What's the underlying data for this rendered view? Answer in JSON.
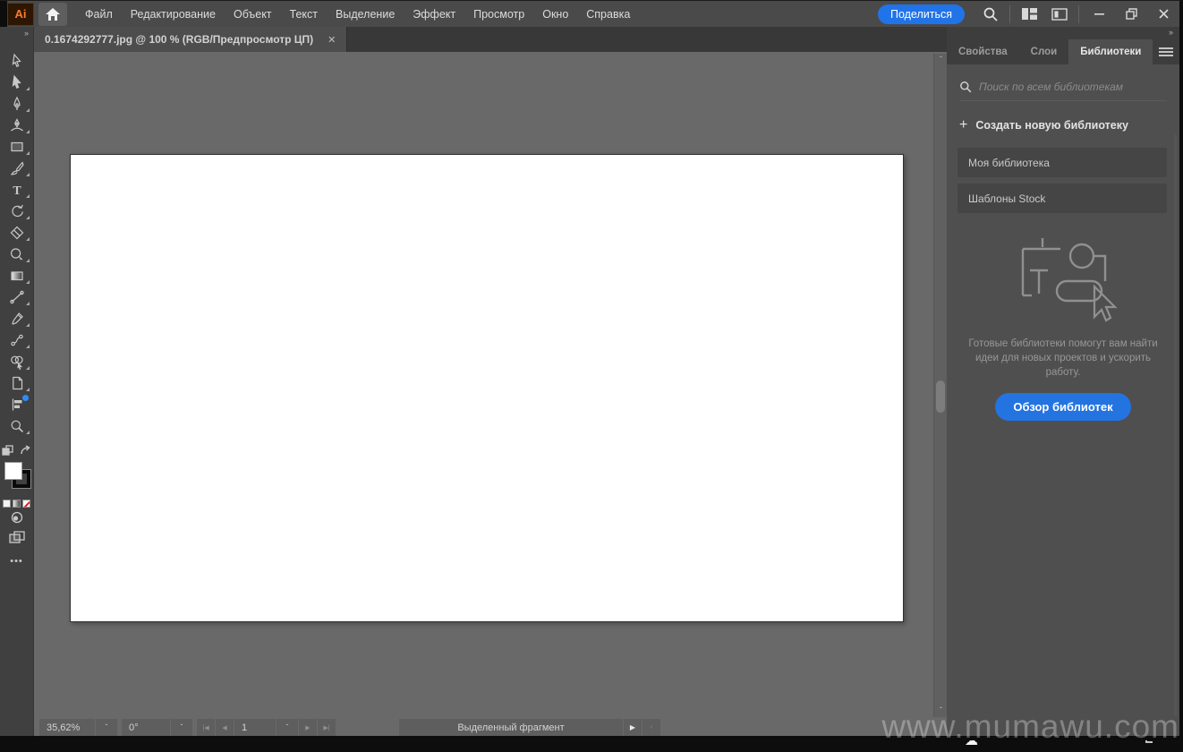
{
  "titlebar": {
    "app_badge": "Ai",
    "menu_items": [
      {
        "id": "file",
        "label": "Файл"
      },
      {
        "id": "edit",
        "label": "Редактирование"
      },
      {
        "id": "object",
        "label": "Объект"
      },
      {
        "id": "type",
        "label": "Текст"
      },
      {
        "id": "select",
        "label": "Выделение"
      },
      {
        "id": "effect",
        "label": "Эффект"
      },
      {
        "id": "view",
        "label": "Просмотр"
      },
      {
        "id": "window",
        "label": "Окно"
      },
      {
        "id": "help",
        "label": "Справка"
      }
    ],
    "share_button": "Поделиться"
  },
  "document_tab": {
    "title": "0.1674292777.jpg @ 100 % (RGB/Предпросмотр ЦП)"
  },
  "toolbar": {
    "tools": [
      {
        "id": "selection-tool",
        "flyout": false
      },
      {
        "id": "direct-selection-tool",
        "flyout": true
      },
      {
        "id": "pen-tool",
        "flyout": true
      },
      {
        "id": "curvature-tool",
        "flyout": true
      },
      {
        "id": "rectangle-tool",
        "flyout": true
      },
      {
        "id": "paintbrush-tool",
        "flyout": true
      },
      {
        "id": "type-tool",
        "flyout": true
      },
      {
        "id": "rotate-tool",
        "flyout": true
      },
      {
        "id": "eraser-tool",
        "flyout": true
      },
      {
        "id": "scale-tool",
        "flyout": true
      },
      {
        "id": "gradient-tool",
        "flyout": true
      },
      {
        "id": "width-tool",
        "flyout": true
      },
      {
        "id": "eyedropper-tool",
        "flyout": true
      },
      {
        "id": "blend-tool",
        "flyout": true
      },
      {
        "id": "shape-builder-tool",
        "flyout": true
      },
      {
        "id": "artboard-tool",
        "flyout": true
      },
      {
        "id": "graph-tool",
        "flyout": false,
        "badge": true
      },
      {
        "id": "zoom-tool",
        "flyout": true
      }
    ]
  },
  "libraries_panel": {
    "tabs": [
      {
        "id": "properties",
        "label": "Свойства",
        "active": false
      },
      {
        "id": "layers",
        "label": "Слои",
        "active": false
      },
      {
        "id": "libraries",
        "label": "Библиотеки",
        "active": true
      }
    ],
    "search_placeholder": "Поиск по всем библиотекам",
    "create_new_label": "Создать новую библиотеку",
    "items": [
      {
        "id": "my-library",
        "label": "Моя библиотека"
      },
      {
        "id": "stock-templates",
        "label": "Шаблоны Stock"
      }
    ],
    "empty_text": "Готовые библиотеки помогут вам найти идеи для новых проектов и ускорить работу.",
    "browse_button": "Обзор библиотек"
  },
  "statusbar": {
    "zoom": "35,62%",
    "rotation": "0°",
    "page": "1",
    "mode_label": "Выделенный фрагмент"
  },
  "watermark": "www.mumawu.com",
  "colors": {
    "accent_blue": "#2374e1",
    "topbar": "#4a4a4a",
    "canvas": "#696969",
    "panel": "#4f4f4f",
    "ai_logo_orange": "#ff7a2e"
  }
}
